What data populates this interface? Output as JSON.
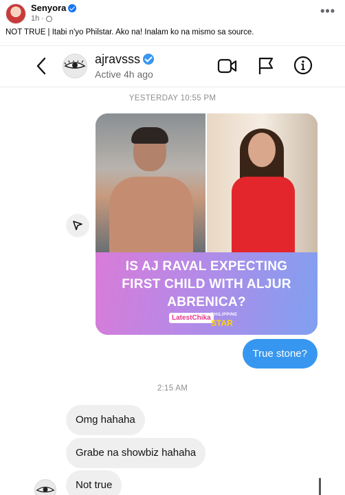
{
  "post": {
    "author": "Senyora",
    "time": "1h",
    "caption": "NOT TRUE | Itabi n'yo Philstar. Ako na! Inalam ko na mismo sa source.",
    "more_label": "•••"
  },
  "dm": {
    "username": "ajravsss",
    "status": "Active 4h ago",
    "timestamp_1": "YESTERDAY 10:55 PM",
    "timestamp_2": "2:15 AM"
  },
  "shared_post": {
    "headline": "IS AJ RAVAL EXPECTING FIRST CHILD WITH ALJUR ABRENICA?",
    "logo_left": "LatestChika",
    "logo_right_small": "PHILIPPINE",
    "logo_right": "STAR"
  },
  "messages": {
    "sent": "True stone?",
    "received": [
      "Omg hahaha",
      "Grabe na showbiz hahaha",
      "Not true"
    ]
  },
  "colors": {
    "sent_bubble": "#3797f0",
    "received_bubble": "#efefef",
    "verified": "#3897f0"
  },
  "icons": [
    "globe-icon",
    "more-icon",
    "back-icon",
    "verified-icon",
    "video-call-icon",
    "flag-icon",
    "info-icon",
    "share-icon"
  ]
}
